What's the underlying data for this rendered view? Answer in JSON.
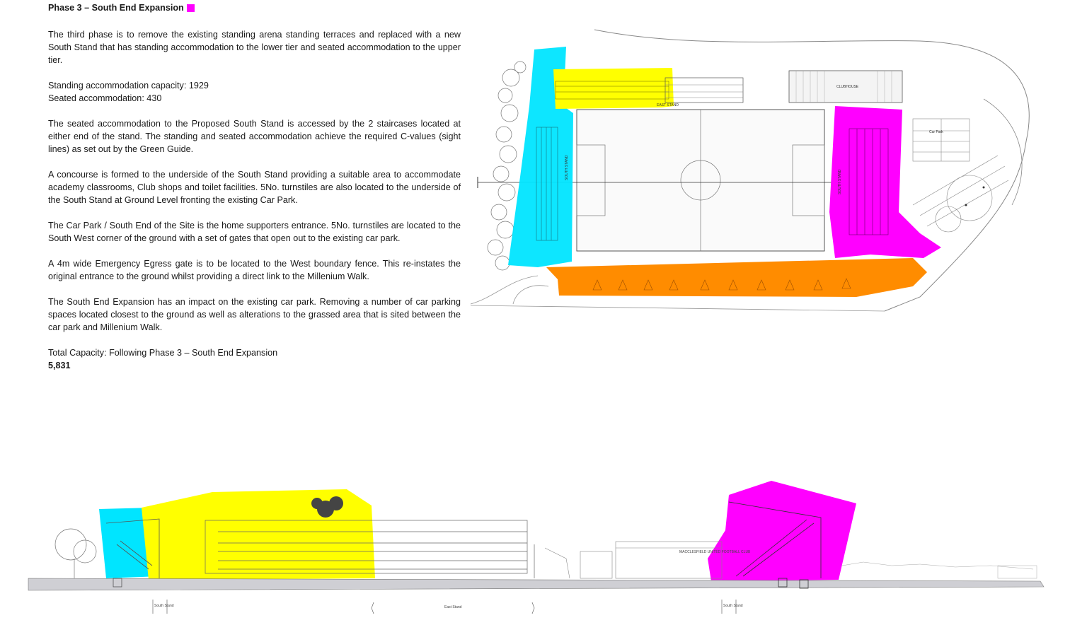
{
  "document": {
    "heading": "Phase 3 – South End Expansion",
    "heading_swatch_color": "#ff00ff",
    "paragraphs": [
      "The third phase is to remove the existing standing arena standing terraces and replaced with a new South Stand that has standing accommodation to the lower tier and seated accommodation to the upper tier.",
      "The seated accommodation to the Proposed South Stand is accessed by the 2 staircases located at either end  of the stand. The standing and seated accommodation achieve the required C-values (sight lines) as set out by the Green Guide.",
      "A concourse is formed to the underside of the South Stand providing a suitable area to accommodate academy classrooms, Club shops and toilet facilities. 5No. turnstiles are also located to the underside of the South Stand at Ground Level fronting the existing Car Park.",
      "The Car Park / South End of the Site is the home supporters entrance. 5No. turnstiles are located to the South West corner of the ground with a set of gates that open out to the existing car park.",
      "A 4m wide Emergency Egress gate is to be located to the West boundary fence. This re-instates the original entrance to the ground whilst providing a direct link to the Millenium Walk.",
      "The South End Expansion has an impact on the existing car park. Removing a number of car parking spaces located closest to the ground as well as alterations to the grassed area that is sited between the car park and Millenium Walk."
    ],
    "capacity": {
      "standing": "Standing accommodation capacity: 1929",
      "seated": "Seated accommodation: 430"
    },
    "total": {
      "label": "Total Capacity: Following Phase 3 – South End Expansion",
      "value": "5,831"
    }
  },
  "site_plan": {
    "labels": {
      "east_stand": "EAST STAND",
      "clubhouse": "CLUBHOUSE",
      "car_park": "Car Park",
      "south_stand_left": "SOUTH STAND",
      "south_stand_right": "SOUTH STAND"
    },
    "colors": {
      "cyan": "#00e5ff",
      "yellow": "#ffff00",
      "magenta": "#ff00ff",
      "orange": "#ff8c00",
      "lines": "#444444"
    }
  },
  "section": {
    "labels": {
      "south_stand_left": "South Stand",
      "east_stand": "East Stand",
      "south_stand_right": "South Stand",
      "club_sign": "MACCLESFIELD UNITED FOOTBALL CLUB"
    }
  }
}
